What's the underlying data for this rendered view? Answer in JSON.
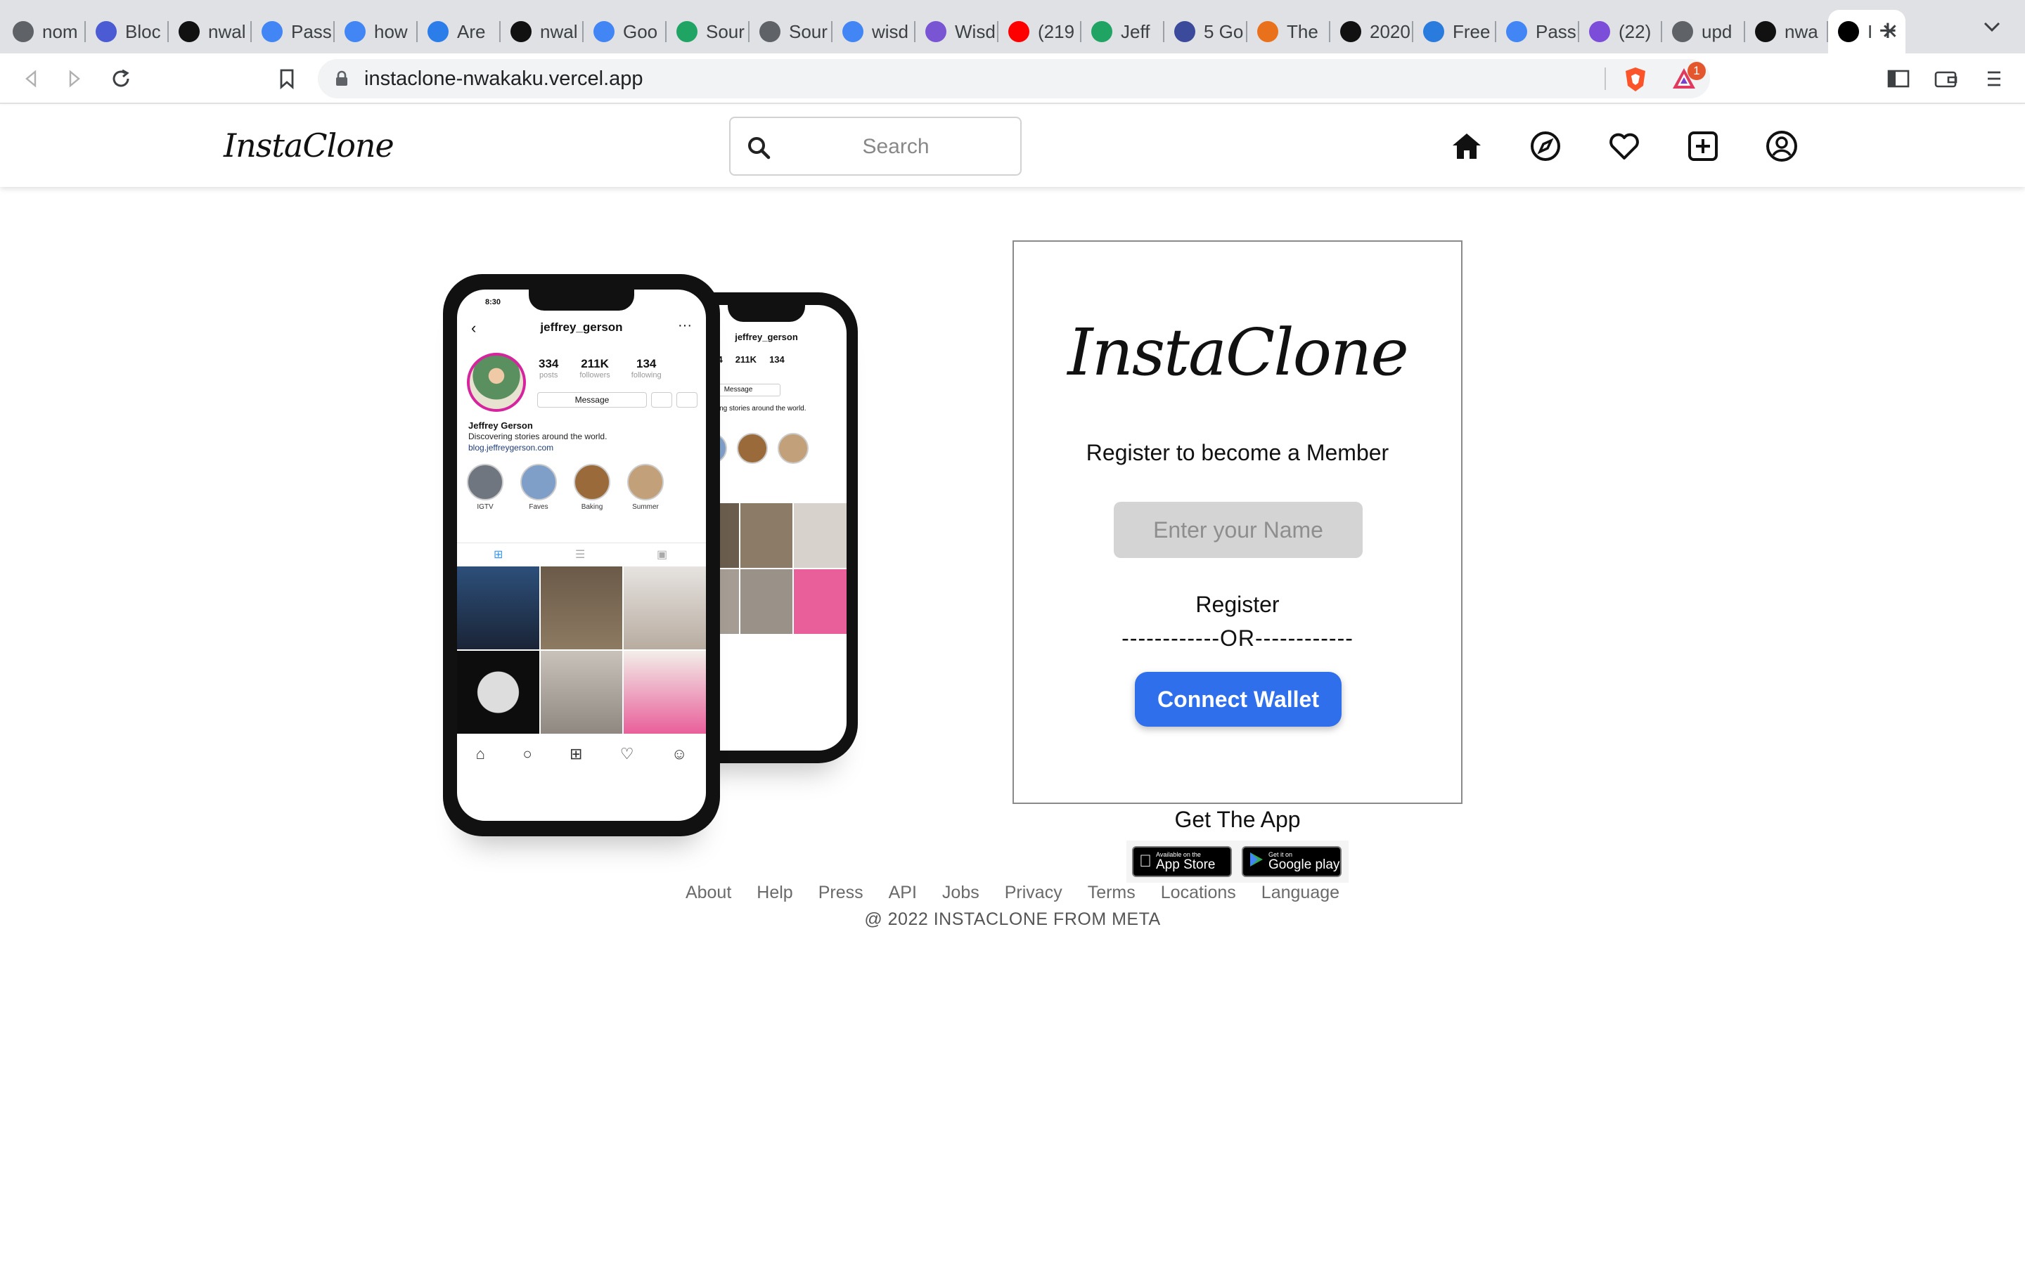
{
  "browser": {
    "tabs": [
      {
        "label": "nom",
        "favicon": "globe-icon",
        "color": "#5f6368"
      },
      {
        "label": "Bloc",
        "favicon": "hexagon-icon",
        "color": "#4b5bd4"
      },
      {
        "label": "nwal",
        "favicon": "github-icon",
        "color": "#111111"
      },
      {
        "label": "Pass",
        "favicon": "google-icon",
        "color": "#4285f4"
      },
      {
        "label": "how",
        "favicon": "google-icon",
        "color": "#4285f4"
      },
      {
        "label": "Are",
        "favicon": "mk-icon",
        "color": "#2b7de9"
      },
      {
        "label": "nwal",
        "favicon": "github-icon",
        "color": "#111111"
      },
      {
        "label": "Goo",
        "favicon": "google-icon",
        "color": "#4285f4"
      },
      {
        "label": "Sour",
        "favicon": "drive-icon",
        "color": "#1fa463"
      },
      {
        "label": "Sour",
        "favicon": "globe-icon",
        "color": "#5f6368"
      },
      {
        "label": "wisd",
        "favicon": "docs-icon",
        "color": "#4285f4"
      },
      {
        "label": "Wisd",
        "favicon": "wisdom-icon",
        "color": "#7a55d3"
      },
      {
        "label": "(219",
        "favicon": "youtube-icon",
        "color": "#ff0000"
      },
      {
        "label": "Jeff",
        "favicon": "drive-icon",
        "color": "#1fa463"
      },
      {
        "label": "5 Go",
        "favicon": "shield-icon",
        "color": "#3b4a9a"
      },
      {
        "label": "The",
        "favicon": "nbc-icon",
        "color": "#e9711c"
      },
      {
        "label": "2020",
        "favicon": "u-icon",
        "color": "#111111"
      },
      {
        "label": "Free",
        "favicon": "filter-icon",
        "color": "#2a7bde"
      },
      {
        "label": "Pass",
        "favicon": "google-icon",
        "color": "#4285f4"
      },
      {
        "label": "(22)",
        "favicon": "calendar-icon",
        "color": "#7b4dd8"
      },
      {
        "label": "upd",
        "favicon": "globe-icon",
        "color": "#5f6368"
      },
      {
        "label": "nwa",
        "favicon": "github-icon",
        "color": "#111111"
      },
      {
        "label": "I",
        "favicon": "vercel-icon",
        "color": "#000000",
        "active": true
      }
    ],
    "url": "instaclone-nwakaku.vercel.app",
    "rewards_badge": "1"
  },
  "header": {
    "logo": "InstaClone",
    "search_placeholder": "Search",
    "nav_icons": [
      "home-icon",
      "explore-icon",
      "heart-icon",
      "new-post-icon",
      "profile-icon"
    ]
  },
  "phone": {
    "username": "jeffrey_gerson",
    "stats": [
      {
        "value": "334",
        "label": "posts"
      },
      {
        "value": "211K",
        "label": "followers"
      },
      {
        "value": "134",
        "label": "following"
      }
    ],
    "message_label": "Message",
    "name": "Jeffrey Gerson",
    "bio": "Discovering stories around the world.",
    "link": "blog.jeffreygerson.com",
    "highlights": [
      "IGTV",
      "Faves",
      "Baking",
      "Summer"
    ],
    "status_time": "8:30"
  },
  "register": {
    "logo": "InstaClone",
    "subtitle": "Register to become a Member",
    "name_placeholder": "Enter your Name",
    "register_label": "Register",
    "or_divider": "------------OR------------",
    "connect_label": "Connect Wallet",
    "accent": "#2f6fec"
  },
  "get_app": {
    "title": "Get The App",
    "app_store_small": "Available on the",
    "app_store_big": "App Store",
    "play_small": "Get it on",
    "play_big": "Google play"
  },
  "footer": {
    "links": [
      "About",
      "Help",
      "Press",
      "API",
      "Jobs",
      "Privacy",
      "Terms",
      "Locations",
      "Language"
    ],
    "copyright": "@ 2022 INSTACLONE FROM META"
  }
}
